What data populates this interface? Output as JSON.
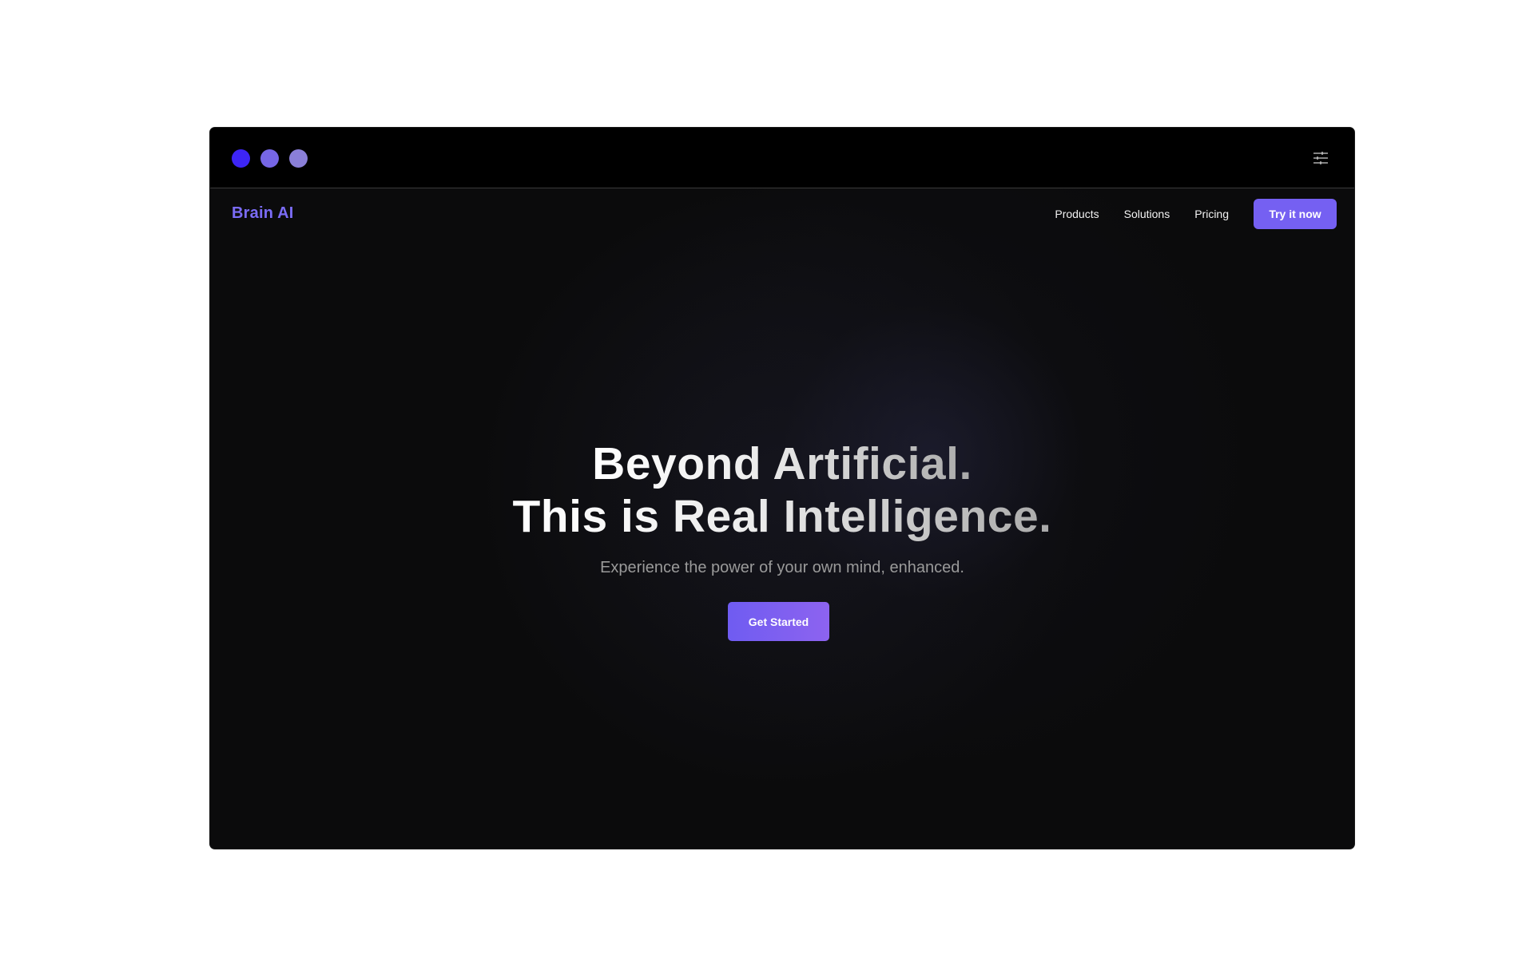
{
  "window": {
    "traffic_lights": [
      {
        "name": "window-dot-1",
        "color": "#3d25f5"
      },
      {
        "name": "window-dot-2",
        "color": "#7666e6"
      },
      {
        "name": "window-dot-3",
        "color": "#8a7fd8"
      }
    ],
    "settings_icon": "sliders-icon"
  },
  "nav": {
    "brand": "Brain AI",
    "links": [
      "Products",
      "Solutions",
      "Pricing"
    ],
    "cta_label": "Try it now"
  },
  "hero": {
    "headline_line1": "Beyond Artificial.",
    "headline_line2": "This is Real Intelligence.",
    "subtitle": "Experience the power of your own mind, enhanced.",
    "cta_label": "Get Started"
  },
  "colors": {
    "accent": "#7560f2",
    "brand_text": "#7b6cf6",
    "background": "#0b0b0c",
    "titlebar": "#000000"
  }
}
